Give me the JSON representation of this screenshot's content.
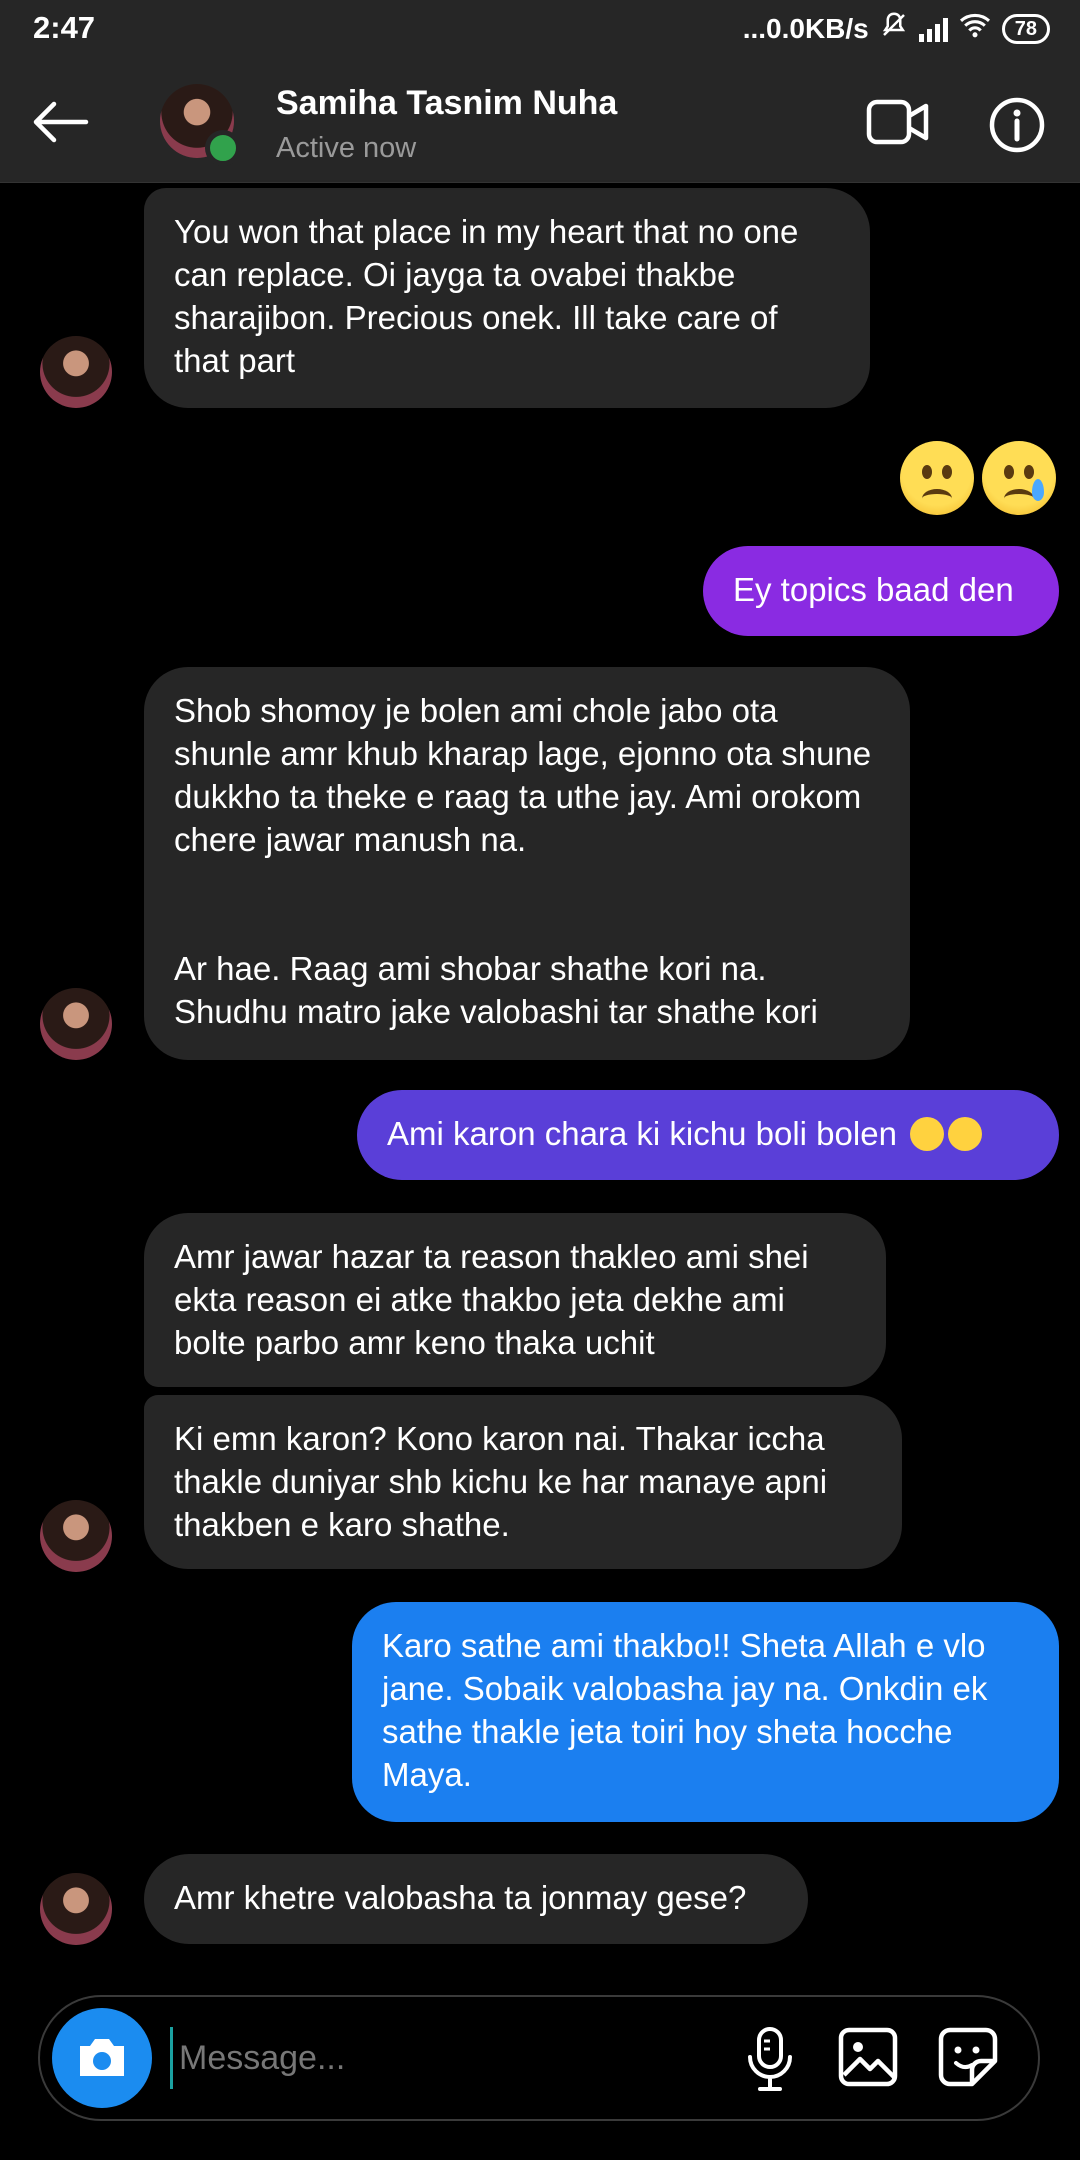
{
  "status_bar": {
    "time": "2:47",
    "network_speed": "...0.0KB/s",
    "battery": "78"
  },
  "header": {
    "contact_name": "Samiha Tasnim Nuha",
    "contact_status": "Active now"
  },
  "messages": [
    {
      "from": "them",
      "text": "You won that place in my heart that no one can replace. Oi jayga ta ovabei thakbe sharajibon. Precious onek. Ill take care of that part"
    },
    {
      "from": "me",
      "type": "emoji",
      "emojis": [
        "worried-face",
        "crying-face"
      ]
    },
    {
      "from": "me",
      "text": "Ey topics baad den",
      "color": "#8a2be2"
    },
    {
      "from": "them",
      "text": "Shob shomoy je bolen ami chole jabo ota shunle amr khub kharap lage, ejonno ota shune dukkho ta theke e raag ta uthe jay. Ami orokom chere jawar manush na.",
      "text2": "Ar hae. Raag ami shobar shathe kori na. Shudhu matro jake valobashi tar shathe kori"
    },
    {
      "from": "me",
      "text": "Ami karon chara ki kichu boli bolen",
      "color": "#5a3fd8"
    },
    {
      "from": "them",
      "text": "Amr jawar hazar ta reason thakleo ami shei ekta reason ei atke thakbo jeta dekhe ami bolte parbo amr keno thaka uchit"
    },
    {
      "from": "them",
      "text": "Ki emn karon? Kono karon nai. Thakar iccha thakle duniyar shb kichu ke har manaye apni thakben e karo shathe."
    },
    {
      "from": "me",
      "text": "Karo sathe ami thakbo!! Sheta Allah e vlo jane. Sobaik valobasha jay na. Onkdin ek sathe thakle jeta toiri hoy sheta hocche Maya.",
      "color": "#1b7ff0"
    },
    {
      "from": "them",
      "text": "Amr khetre valobasha ta jonmay gese?"
    }
  ],
  "composer": {
    "placeholder": "Message..."
  }
}
